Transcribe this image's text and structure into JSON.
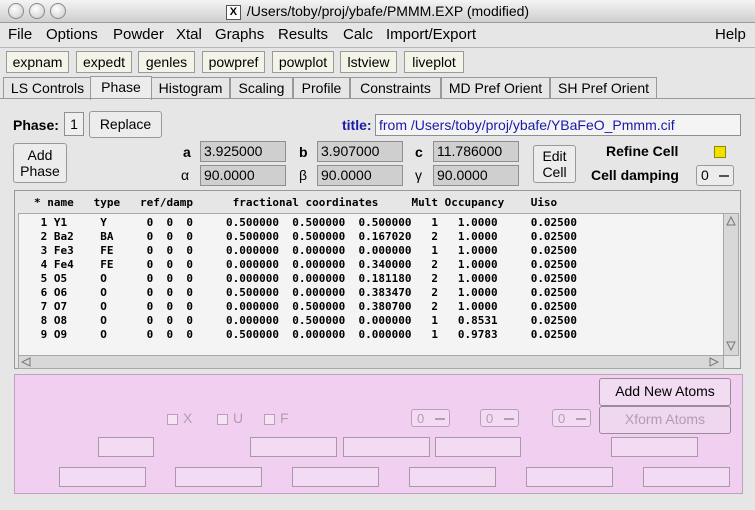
{
  "window": {
    "title": "/Users/toby/proj/ybafe/PMMM.EXP (modified)"
  },
  "menubar": {
    "items": [
      "File",
      "Options",
      "Powder",
      "Xtal",
      "Graphs",
      "Results",
      "Calc",
      "Import/Export"
    ],
    "help": "Help"
  },
  "toolbar": {
    "buttons": [
      "expnam",
      "expedt",
      "genles",
      "powpref",
      "powplot",
      "lstview",
      "liveplot"
    ]
  },
  "tabs": [
    "LS Controls",
    "Phase",
    "Histogram",
    "Scaling",
    "Profile",
    "Constraints",
    "MD Pref Orient",
    "SH Pref Orient"
  ],
  "phase": {
    "label": "Phase:",
    "number": "1",
    "replace": "Replace",
    "title_label": "title:",
    "title_value": "from /Users/toby/proj/ybafe/YBaFeO_Pmmm.cif",
    "add_phase": [
      "Add",
      "Phase"
    ],
    "edit_cell": [
      "Edit",
      "Cell"
    ],
    "cell": {
      "a_label": "a",
      "a": "3.925000",
      "b_label": "b",
      "b": "3.907000",
      "c_label": "c",
      "c": "11.786000",
      "alpha_label": "α",
      "alpha": "90.0000",
      "beta_label": "β",
      "beta": "90.0000",
      "gamma_label": "γ",
      "gamma": "90.0000"
    },
    "refine_cell": "Refine Cell",
    "cell_damping": "Cell damping",
    "cell_damping_value": "0"
  },
  "atoms": {
    "header": "* name   type   ref/damp      fractional coordinates     Mult Occupancy    Uiso",
    "rows": [
      " 1 Y1     Y      0  0  0     0.500000  0.500000  0.500000   1   1.0000     0.02500",
      " 2 Ba2    BA     0  0  0     0.500000  0.500000  0.167020   2   1.0000     0.02500",
      " 3 Fe3    FE     0  0  0     0.000000  0.000000  0.000000   1   1.0000     0.02500",
      " 4 Fe4    FE     0  0  0     0.000000  0.000000  0.340000   2   1.0000     0.02500",
      " 5 O5     O      0  0  0     0.000000  0.000000  0.181180   2   1.0000     0.02500",
      " 6 O6     O      0  0  0     0.500000  0.000000  0.383470   2   1.0000     0.02500",
      " 7 O7     O      0  0  0     0.000000  0.500000  0.380700   2   1.0000     0.02500",
      " 8 O8     O      0  0  0     0.000000  0.500000  0.000000   1   0.8531     0.02500",
      " 9 O9     O      0  0  0     0.500000  0.000000  0.000000   1   0.9783     0.02500"
    ]
  },
  "edit_panel": {
    "add_new_atoms": "Add New Atoms",
    "xform_atoms": "Xform Atoms",
    "checks": [
      "X",
      "U",
      "F"
    ],
    "damps": [
      "0",
      "0",
      "0"
    ]
  },
  "colors": {
    "panel_pink": "#f0cff0",
    "refine_indicator": "#f5e000",
    "title_value_bg": "#f4f4f4"
  }
}
